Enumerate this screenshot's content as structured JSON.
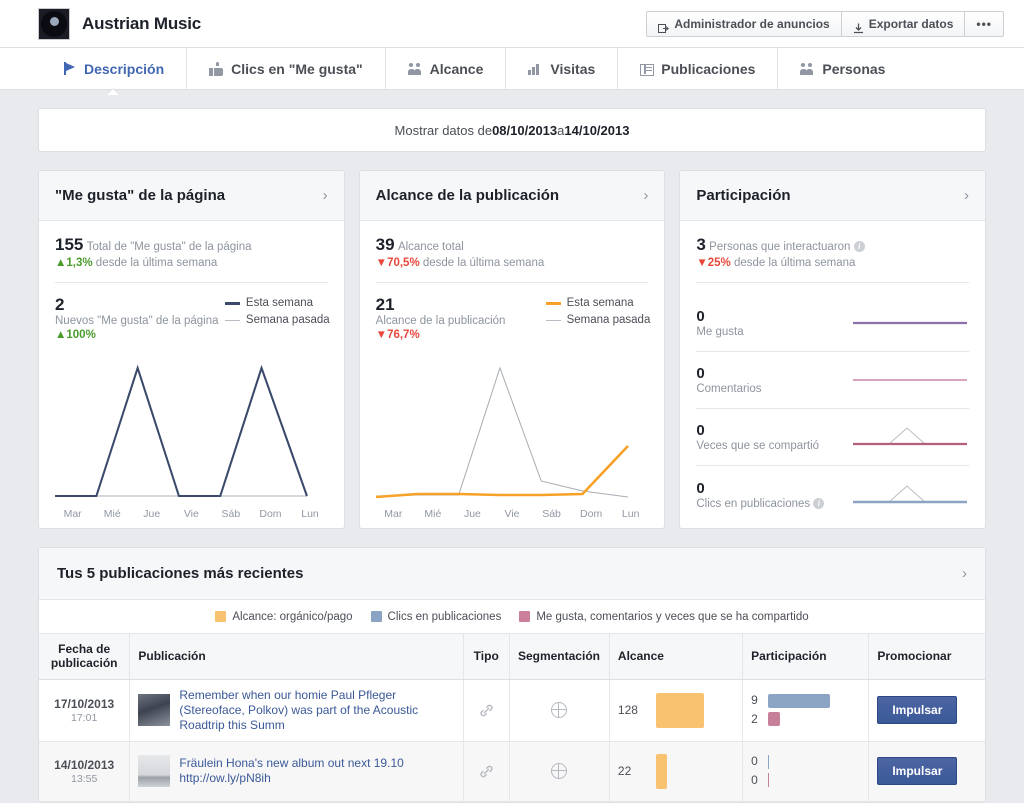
{
  "header": {
    "page_name": "Austrian Music",
    "avatar_icon": "record-avatar",
    "buttons": [
      {
        "label": "Administrador de anuncios",
        "icon": "ads-manager-icon"
      },
      {
        "label": "Exportar datos",
        "icon": "download-icon"
      },
      {
        "label": "•••",
        "icon": "more-options-icon"
      }
    ]
  },
  "tabs": [
    {
      "label": "Descripción",
      "icon": "flag-icon",
      "active": true
    },
    {
      "label": "Clics en \"Me gusta\"",
      "icon": "thumbs-up-icon",
      "active": false
    },
    {
      "label": "Alcance",
      "icon": "people-icon",
      "active": false
    },
    {
      "label": "Visitas",
      "icon": "bar-chart-icon",
      "active": false
    },
    {
      "label": "Publicaciones",
      "icon": "window-list-icon",
      "active": false
    },
    {
      "label": "Personas",
      "icon": "group-icon",
      "active": false
    }
  ],
  "date_range": {
    "prefix": "Mostrar datos de ",
    "from": "08/10/2013",
    "joiner": " a ",
    "to": "14/10/2013"
  },
  "cards": [
    {
      "title": "\"Me gusta\" de la página",
      "chevron": "›",
      "primary": {
        "value": "155",
        "label": "Total de \"Me gusta\" de la página"
      },
      "primary_delta": {
        "arrow": "▲",
        "pct": "1,3%",
        "rest": " desde la última semana",
        "dir": "up"
      },
      "secondary": {
        "value": "2",
        "label": "Nuevos \"Me gusta\" de la página"
      },
      "secondary_delta": {
        "arrow": "▲",
        "pct": "100%",
        "rest": "",
        "dir": "up"
      },
      "legend": [
        {
          "label": "Esta semana",
          "color": "#3b4a6b"
        },
        {
          "label": "Semana pasada",
          "color": "#b9bcc2"
        }
      ]
    },
    {
      "title": "Alcance de la publicación",
      "chevron": "›",
      "primary": {
        "value": "39",
        "label": "Alcance total"
      },
      "primary_delta": {
        "arrow": "▼",
        "pct": "70,5%",
        "rest": " desde la última semana",
        "dir": "down"
      },
      "secondary": {
        "value": "21",
        "label": "Alcance de la publicación"
      },
      "secondary_delta": {
        "arrow": "▼",
        "pct": "76,7%",
        "rest": "",
        "dir": "down"
      },
      "legend": [
        {
          "label": "Esta semana",
          "color": "#f7a128"
        },
        {
          "label": "Semana pasada",
          "color": "#b9bcc2"
        }
      ]
    },
    {
      "title": "Participación",
      "chevron": "›",
      "primary": {
        "value": "3",
        "label": "Personas que interactuaron",
        "info": "i"
      },
      "primary_delta": {
        "arrow": "▼",
        "pct": "25%",
        "rest": " desde la última semana",
        "dir": "down"
      },
      "rows": [
        {
          "value": "0",
          "label": "Me gusta",
          "color": "#8a6fa8",
          "peak": false
        },
        {
          "value": "0",
          "label": "Comentarios",
          "color": "#d8a5bc",
          "peak": false
        },
        {
          "value": "0",
          "label": "Veces que se compartió",
          "color": "#b25f7e",
          "peak": true
        },
        {
          "value": "0",
          "label": "Clics en publicaciones",
          "color": "#8ba4c4",
          "peak": true,
          "info": "i"
        }
      ]
    }
  ],
  "chart_data": [
    {
      "type": "line",
      "title": "Nuevos \"Me gusta\" de la página",
      "categories": [
        "Mar",
        "Mié",
        "Jue",
        "Vie",
        "Sáb",
        "Dom",
        "Lun"
      ],
      "series": [
        {
          "name": "Esta semana",
          "color": "#3b4a6b",
          "values": [
            0,
            0,
            2,
            0,
            0,
            2,
            0
          ]
        },
        {
          "name": "Semana pasada",
          "color": "#b9bcc2",
          "values": [
            0,
            0,
            0,
            0,
            0,
            0,
            0
          ]
        }
      ],
      "ylim": [
        0,
        2
      ],
      "grid": false,
      "legend_position": "top-right"
    },
    {
      "type": "line",
      "title": "Alcance de la publicación",
      "categories": [
        "Mar",
        "Mié",
        "Jue",
        "Vie",
        "Sáb",
        "Dom",
        "Lun"
      ],
      "series": [
        {
          "name": "Esta semana",
          "color": "#f7a128",
          "values": [
            0,
            0,
            0,
            0,
            0,
            0,
            14
          ]
        },
        {
          "name": "Semana pasada",
          "color": "#b9bcc2",
          "values": [
            0,
            0,
            0,
            30,
            3,
            1,
            0
          ]
        }
      ],
      "ylim": [
        0,
        30
      ],
      "grid": false,
      "legend_position": "top-right"
    },
    {
      "type": "line",
      "title": "Me gusta",
      "categories": [
        "Mar",
        "Mié",
        "Jue",
        "Vie",
        "Sáb",
        "Dom",
        "Lun"
      ],
      "series": [
        {
          "name": "Me gusta",
          "color": "#8a6fa8",
          "values": [
            0,
            0,
            0,
            0,
            0,
            0,
            0
          ]
        }
      ],
      "grid": false
    },
    {
      "type": "line",
      "title": "Comentarios",
      "categories": [
        "Mar",
        "Mié",
        "Jue",
        "Vie",
        "Sáb",
        "Dom",
        "Lun"
      ],
      "series": [
        {
          "name": "Comentarios",
          "color": "#d8a5bc",
          "values": [
            0,
            0,
            0,
            0,
            0,
            0,
            0
          ]
        }
      ],
      "grid": false
    },
    {
      "type": "line",
      "title": "Veces que se compartió",
      "categories": [
        "Mar",
        "Mié",
        "Jue",
        "Vie",
        "Sáb",
        "Dom",
        "Lun"
      ],
      "series": [
        {
          "name": "Veces que se compartió",
          "color": "#b25f7e",
          "values": [
            0,
            0,
            0,
            1,
            0,
            0,
            0
          ]
        }
      ],
      "grid": false
    },
    {
      "type": "line",
      "title": "Clics en publicaciones",
      "categories": [
        "Mar",
        "Mié",
        "Jue",
        "Vie",
        "Sáb",
        "Dom",
        "Lun"
      ],
      "series": [
        {
          "name": "Clics en publicaciones",
          "color": "#8ba4c4",
          "values": [
            0,
            0,
            0,
            1,
            0,
            0,
            0
          ]
        }
      ],
      "grid": false
    },
    {
      "type": "bar",
      "title": "Alcance por publicación",
      "categories": [
        "17/10/2013",
        "14/10/2013"
      ],
      "values": [
        128,
        22
      ],
      "ylabel": "Alcance"
    },
    {
      "type": "bar",
      "title": "Participación por publicación",
      "categories": [
        "17/10/2013",
        "14/10/2013"
      ],
      "series": [
        {
          "name": "Clics en publicaciones",
          "color": "#8ba4c4",
          "values": [
            9,
            0
          ]
        },
        {
          "name": "Me gusta, comentarios y veces que se ha compartido",
          "color": "#b25f7e",
          "values": [
            2,
            0
          ]
        }
      ]
    }
  ],
  "posts_panel": {
    "title": "Tus 5 publicaciones más recientes",
    "chevron": "›",
    "legend": [
      {
        "label": "Alcance: orgánico/pago",
        "color": "#f9c270"
      },
      {
        "label": "Clics en publicaciones",
        "color": "#8ba4c4"
      },
      {
        "label": "Me gusta, comentarios y veces que se ha compartido",
        "color": "#cc7f9b"
      }
    ],
    "columns": [
      "Fecha de publicación",
      "Publicación",
      "Tipo",
      "Segmentación",
      "Alcance",
      "Participación",
      "Promocionar"
    ],
    "rows": [
      {
        "date": "17/10/2013",
        "time": "17:01",
        "text": "Remember when our homie Paul Pfleger (Stereoface, Polkov) was part of the Acoustic Roadtrip this Summ",
        "thumb": "photo-thumb-dark",
        "type_icon": "link-icon",
        "targeting_icon": "globe-icon",
        "reach": "128",
        "reach_bar_w": 48,
        "reach_bar_h": 35,
        "eng_clicks": "9",
        "eng_likes": "2",
        "clicks_bar_w": 62,
        "likes_bar_w": 12,
        "promote_label": "Impulsar"
      },
      {
        "date": "14/10/2013",
        "time": "13:55",
        "text": "Fräulein Hona's new album out next 19.10 http://ow.ly/pN8ih",
        "thumb": "photo-thumb-light",
        "type_icon": "link-icon",
        "targeting_icon": "globe-icon",
        "reach": "22",
        "reach_bar_w": 11,
        "reach_bar_h": 35,
        "eng_clicks": "0",
        "eng_likes": "0",
        "clicks_bar_w": 1,
        "likes_bar_w": 1,
        "promote_label": "Impulsar"
      }
    ]
  }
}
